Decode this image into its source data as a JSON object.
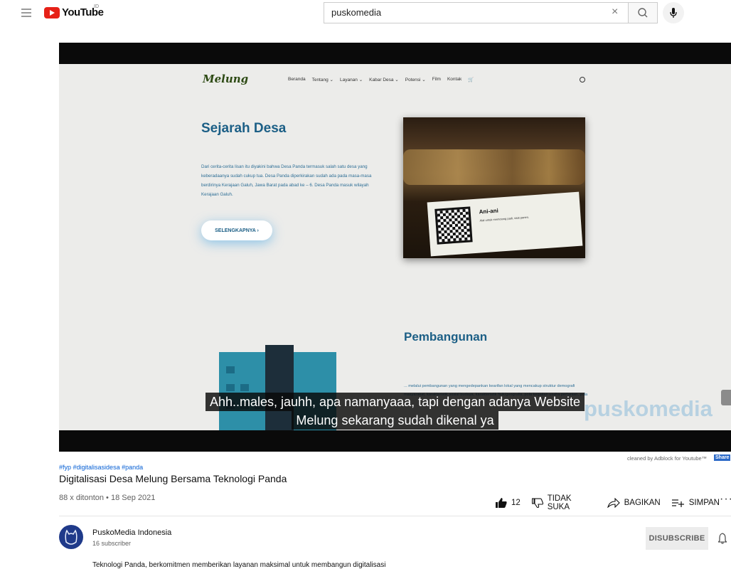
{
  "header": {
    "logo_text": "YouTube",
    "logo_badge": "ID",
    "search_value": "puskomedia",
    "clear_symbol": "×",
    "icons": [
      "menu-icon",
      "search-icon",
      "mic-icon"
    ]
  },
  "video_frame": {
    "site_logo": "Melung",
    "nav": [
      "Beranda",
      "Tentang ⌄",
      "Layanan ⌄",
      "Kabar Desa ⌄",
      "Potensi ⌄",
      "Film",
      "Kontak"
    ],
    "heading": "Sejarah Desa",
    "paragraph": "Dari cerita-cerita lisan itu diyakini bahwa Desa Panda termasuk salah satu desa yang keberadaanya sudah cukup tua. Desa Panda diperkirakan sudah ada pada masa-masa berdirinya Kerajaan Galuh, Jawa Barat pada abad ke – 6. Desa Panda masuk wilayah Kerajaan Galuh.",
    "button": "SELENGKAPNYA ›",
    "photo_card_title": "Ani-ani",
    "photo_card_text": "Alat untuk memotong padi, saat panen.",
    "heading2": "Pembangunan",
    "paragraph2": "... melalui pembangunan yang mengedepankan kearifan lokal yang mencakup struktur demografi masyarakat, karakteristik sosial budaya, karakteristik fisik/geografis, pola kegiatan usaha pertanian, pola",
    "watermark": "puskomedia",
    "caption_line1": "Ahh..males, jauhh, apa namanyaaa, tapi dengan adanya Website",
    "caption_line2": "Melung sekarang sudah dikenal ya"
  },
  "adblock_note": "cleaned by Adblock for Youtube™",
  "adblock_share": "Share",
  "video": {
    "tags": [
      "#fyp",
      "#digitalisasidesa",
      "#panda"
    ],
    "title": "Digitalisasi Desa Melung Bersama Teknologi Panda",
    "meta": "88 x ditonton • 18 Sep 2021",
    "likes": "12",
    "dislike_label": "TIDAK SUKA",
    "share_label": "BAGIKAN",
    "save_label": "SIMPAN",
    "more": "···"
  },
  "channel": {
    "name": "PuskoMedia Indonesia",
    "subscribers": "16 subscriber",
    "button": "DISUBSCRIBE",
    "description": "Teknologi Panda, berkomitmen memberikan layanan maksimal untuk membangun digitalisasi"
  },
  "colors": {
    "brand_red": "#e62117",
    "link_blue": "#065fd4",
    "site_blue": "#1c5f86"
  }
}
